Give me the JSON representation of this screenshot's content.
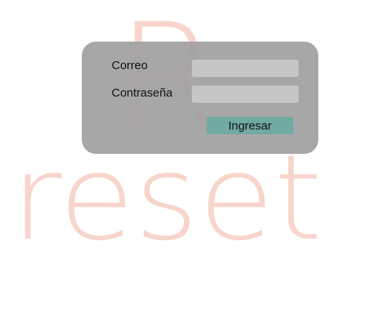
{
  "brand": {
    "logo_letter": "R",
    "logo_word": "reset",
    "logo_color": "#f8d5cc"
  },
  "login_form": {
    "email_label": "Correo",
    "email_value": "",
    "password_label": "Contraseña",
    "password_value": "",
    "submit_label": "Ingresar"
  },
  "colors": {
    "card_background": "#a0a0a0",
    "input_background": "#c6c6c6",
    "button_background": "#70aaa3"
  }
}
